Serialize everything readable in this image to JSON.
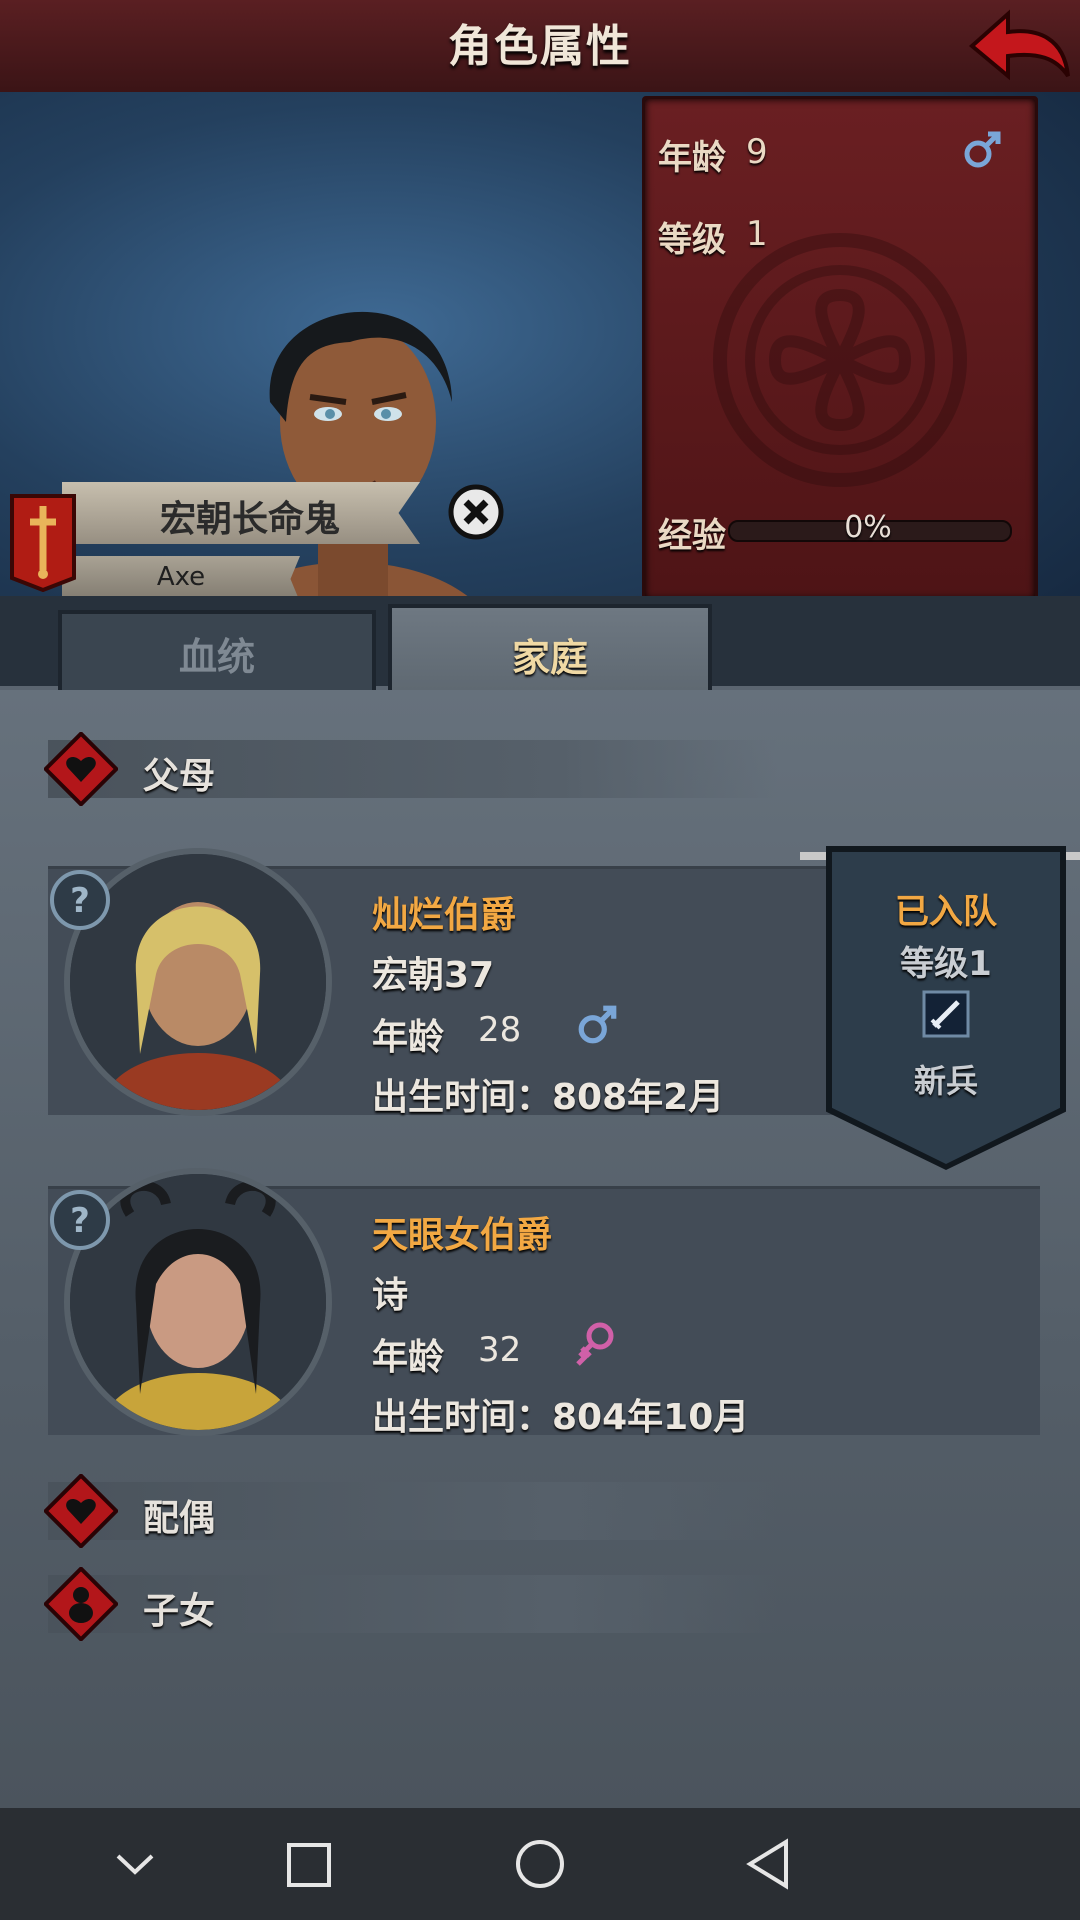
{
  "header": {
    "title": "角色属性",
    "back_icon": "red-arrow-back-icon"
  },
  "character": {
    "name": "宏朝长命鬼",
    "subname": "Axe",
    "stats": {
      "age_label": "年龄",
      "age_value": "9",
      "level_label": "等级",
      "level_value": "1",
      "exp_label": "经验",
      "exp_value": "0%",
      "exp_fraction": 0,
      "gender_icon": "male-icon"
    }
  },
  "tabs": [
    {
      "label": "血统",
      "active": false
    },
    {
      "label": "家庭",
      "active": true
    }
  ],
  "sections": {
    "parents": {
      "label": "父母",
      "icon": "heart-icon"
    },
    "spouse": {
      "label": "配偶",
      "icon": "heart-icon"
    },
    "children": {
      "label": "子女",
      "icon": "child-icon"
    }
  },
  "parents": [
    {
      "name": "灿烂伯爵",
      "house": "宏朝37",
      "age_label": "年龄",
      "age": "28",
      "gender": "male",
      "birth": "出生时间：808年2月"
    },
    {
      "name": "天眼女伯爵",
      "house": "诗",
      "age_label": "年龄",
      "age": "32",
      "gender": "female",
      "birth": "出生时间：804年10月"
    }
  ],
  "party_banner": {
    "status": "已入队",
    "level": "等级1",
    "role": "新兵",
    "role_icon": "sword-icon"
  },
  "colors": {
    "accent_name": "#f2a843",
    "party_status": "#f2a843",
    "header_red": "#5a1f22",
    "male": "#7aa6d8",
    "female": "#d060a8"
  }
}
